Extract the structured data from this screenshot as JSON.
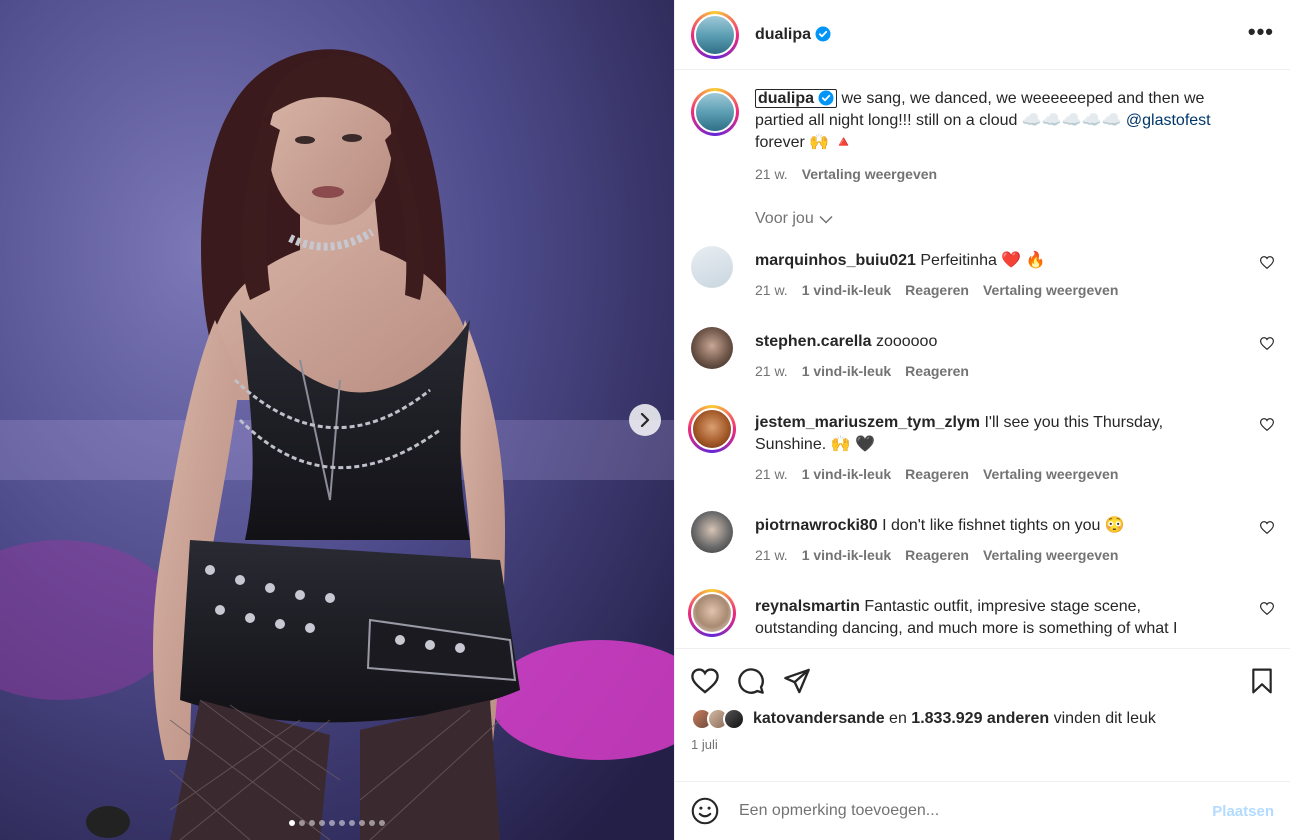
{
  "post": {
    "username": "dualipa",
    "verified": true,
    "more_label": "•••"
  },
  "caption": {
    "username": "dualipa",
    "text": "we sang, we danced, we weeeeeeped and then we partied all night long!!! still on a cloud ☁️☁️☁️☁️☁️",
    "mention": "@glastofest",
    "text_after": " forever 🙌 🔺",
    "time": "21 w.",
    "translate": "Vertaling weergeven"
  },
  "for_you": "Voor jou",
  "comments": [
    {
      "user": "marquinhos_buiu021",
      "text": "Perfeitinha ❤️ 🔥",
      "time": "21 w.",
      "likes": "1 vind-ik-leuk",
      "reply": "Reageren",
      "translate": "Vertaling weergeven"
    },
    {
      "user": "stephen.carella",
      "text": "zoooooo",
      "time": "21 w.",
      "likes": "1 vind-ik-leuk",
      "reply": "Reageren",
      "translate": ""
    },
    {
      "user": "jestem_mariuszem_tym_zlym",
      "text": "I'll see you this Thursday, Sunshine. 🙌 🖤",
      "time": "21 w.",
      "likes": "1 vind-ik-leuk",
      "reply": "Reageren",
      "translate": "Vertaling weergeven"
    },
    {
      "user": "piotrnawrocki80",
      "text": "I don't like fishnet tights on you 😳",
      "time": "21 w.",
      "likes": "1 vind-ik-leuk",
      "reply": "Reageren",
      "translate": "Vertaling weergeven"
    },
    {
      "user": "reynalsmartin",
      "text": "Fantastic outfit, impresive stage scene, outstanding dancing, and much more is something of what I",
      "time": "",
      "likes": "",
      "reply": "",
      "translate": ""
    }
  ],
  "likes": {
    "user": "katovandersande",
    "middle": " en ",
    "count": "1.833.929 anderen",
    "suffix": " vinden dit leuk"
  },
  "date": "1 juli",
  "add_comment": {
    "placeholder": "Een opmerking toevoegen...",
    "post_label": "Plaatsen"
  },
  "carousel": {
    "count": 10,
    "active": 0
  },
  "colors": {
    "link": "#00376b",
    "muted": "#737373",
    "post_disabled": "#b3dbff",
    "verified": "#0095f6"
  },
  "icons": [
    "heart-icon",
    "comment-icon",
    "share-icon",
    "bookmark-icon",
    "emoji-icon",
    "chevron-right-icon",
    "chevron-down-icon"
  ]
}
